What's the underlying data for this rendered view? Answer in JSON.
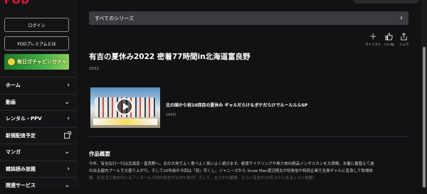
{
  "header": {
    "logo": "FOD"
  },
  "sidebar": {
    "login_label": "ログイン",
    "premium_label": "FODプレミアムとは",
    "banner_text": "毎日ガチャピンガチャ",
    "nav": [
      {
        "label": "ホーム",
        "icon": "chevron-right-icon"
      },
      {
        "label": "動画",
        "icon": "chevron-down-icon"
      },
      {
        "label": "レンタル・PPV",
        "icon": "chevron-right-icon"
      },
      {
        "label": "新規配信予定",
        "icon": "external-link-icon"
      },
      {
        "label": "マンガ",
        "icon": "chevron-down-icon"
      },
      {
        "label": "雑誌読み放題",
        "icon": "chevron-right-icon"
      },
      {
        "label": "関連サービス",
        "icon": "chevron-down-icon"
      }
    ]
  },
  "main": {
    "series_link_label": "すべてのシリーズ",
    "actions": [
      {
        "label": "マイリスト",
        "icon": "plus-icon"
      },
      {
        "label": "いいね",
        "icon": "thumbs-up-icon"
      },
      {
        "label": "シェア",
        "icon": "share-icon"
      }
    ],
    "title": "有吉の夏休み2022 密着77時間in北海道富良野",
    "year": "2022",
    "episode": {
      "title": "北の国から祝10回目の夏休み ギャルだらけ＆ボケだらけでルールルルSP",
      "duration": "104分"
    },
    "summary_heading": "作品概要",
    "summary_line1": "今年、有吉弘行一行は北海道・富良野へ。北の大地でよく食べよく笑いよく遊びます。絶景サイクリングや希少肉の絶品ジンギスカンを大満喫。水着に着替えて波",
    "summary_line2": "の出る屋内プールで大盛り上がり。そして10年前の今回は「初」尽くし。ジャニーズから Snow Man渡辺翔太が初参加や特別企画で全員ギャルに変身して牧場体",
    "summary_line3": "験。私生活で彼女がいるアンガールズ田中卓志がなぜか告白？そして、まさかの展開。さらに有吉が10年ぶりにあることに挑戦！"
  },
  "colors": {
    "background": "#121214",
    "logo": "#e8173a",
    "series_bar": "#3a3a3f"
  }
}
